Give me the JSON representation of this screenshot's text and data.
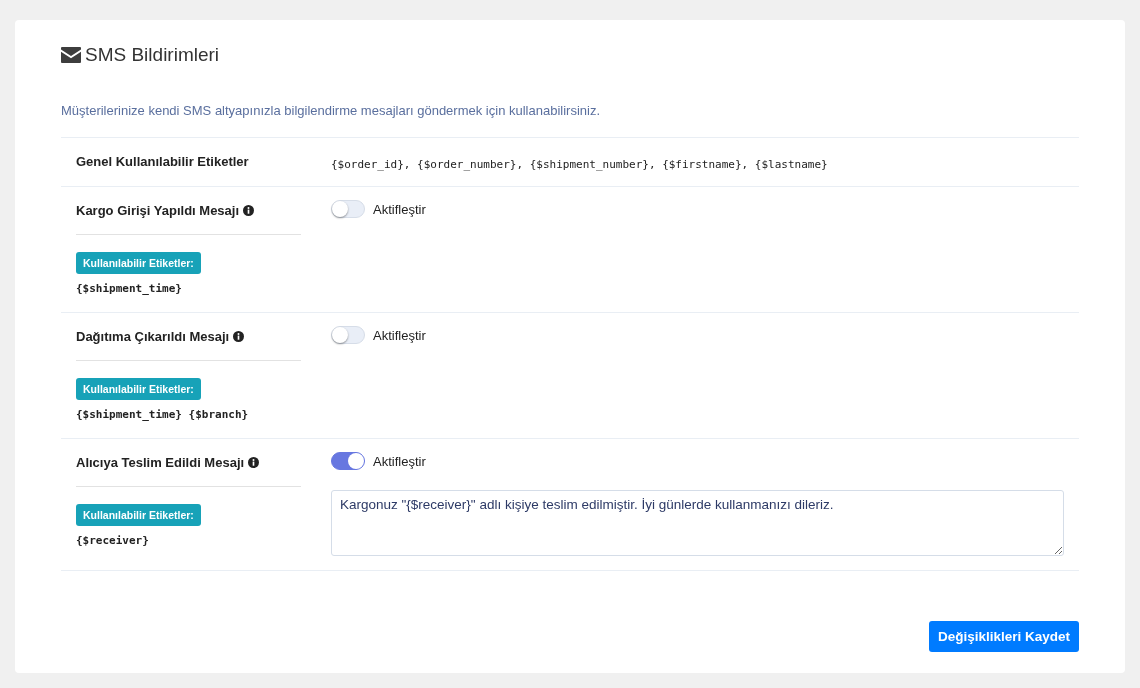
{
  "title": "SMS Bildirimleri",
  "description": "Müşterilerinize kendi SMS altyapınızla bilgilendirme mesajları göndermek için kullanabilirsiniz.",
  "general": {
    "label": "Genel Kullanılabilir Etiketler",
    "tags": "{$order_id}, {$order_number}, {$shipment_number}, {$firstname}, {$lastname}"
  },
  "messages": [
    {
      "label": "Kargo Girişi Yapıldı Mesajı",
      "badge": "Kullanılabilir Etiketler:",
      "tags": "{$shipment_time}",
      "toggle_label": "Aktifleştir",
      "on": false
    },
    {
      "label": "Dağıtıma Çıkarıldı Mesajı",
      "badge": "Kullanılabilir Etiketler:",
      "tags": "{$shipment_time} {$branch}",
      "toggle_label": "Aktifleştir",
      "on": false
    },
    {
      "label": "Alıcıya Teslim Edildi Mesajı",
      "badge": "Kullanılabilir Etiketler:",
      "tags": "{$receiver}",
      "toggle_label": "Aktifleştir",
      "on": true,
      "message": "Kargonuz \"{$receiver}\" adlı kişiye teslim edilmiştir. İyi günlerde kullanmanızı dileriz."
    }
  ],
  "save_button": "Değişiklikleri Kaydet"
}
